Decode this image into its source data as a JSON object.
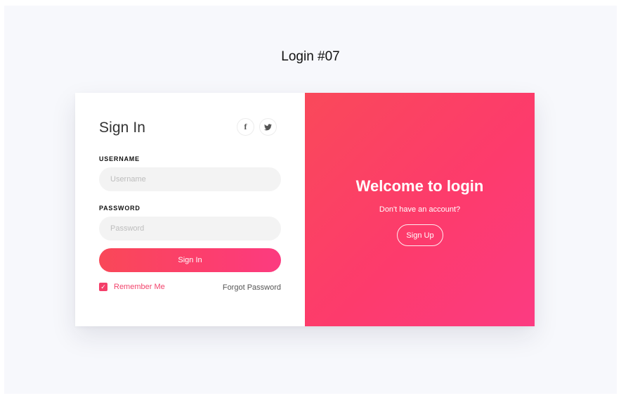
{
  "page": {
    "title": "Login #07"
  },
  "login_panel": {
    "heading": "Sign In",
    "social": {
      "facebook_glyph": "f",
      "facebook_icon": "facebook-icon",
      "twitter_icon": "twitter-icon"
    },
    "username": {
      "label": "USERNAME",
      "placeholder": "Username",
      "value": ""
    },
    "password": {
      "label": "PASSWORD",
      "placeholder": "Password",
      "value": ""
    },
    "submit_label": "Sign In",
    "remember_me": {
      "label": "Remember Me",
      "checked": true
    },
    "forgot_password_label": "Forgot Password"
  },
  "welcome_panel": {
    "title": "Welcome to login",
    "subtitle": "Don't have an account?",
    "sign_up_label": "Sign Up"
  },
  "colors": {
    "accent": "#fc3d6d",
    "accent_start": "#f9495a",
    "accent_end": "#fc3b82",
    "page_background": "#f7f8fc",
    "input_background": "#f3f3f3"
  }
}
